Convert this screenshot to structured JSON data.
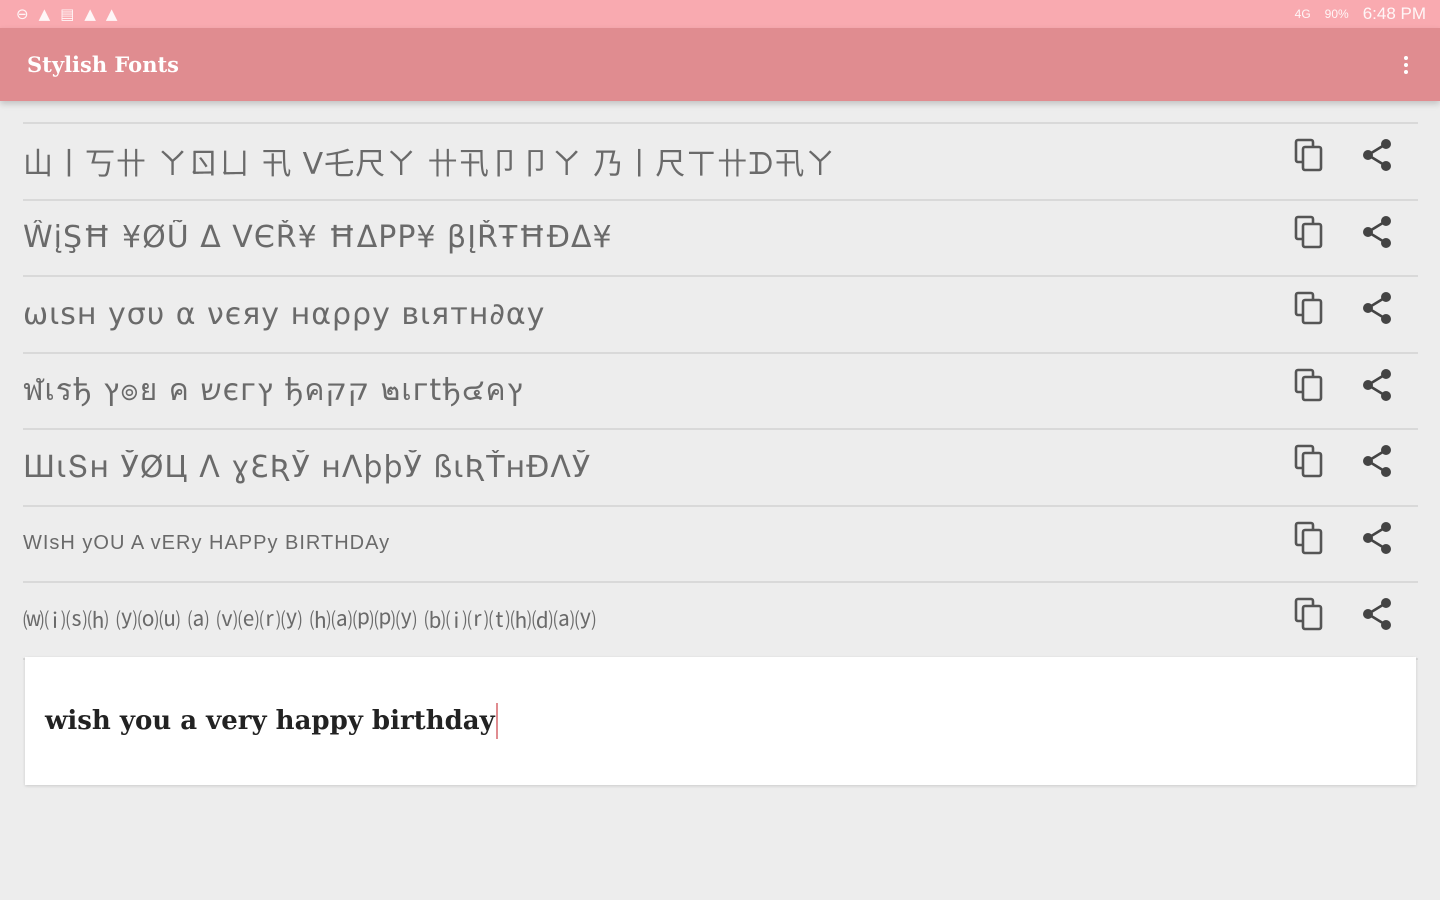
{
  "status_bar": {
    "left_icons": [
      "circle-icon",
      "warning-icon",
      "image-icon",
      "warning-icon",
      "warning-icon"
    ],
    "network": "4G",
    "battery": "90%",
    "time": "6:48 PM"
  },
  "app_bar": {
    "title": "Stylish Fonts",
    "menu_icon": "overflow-menu-icon"
  },
  "fonts": [
    {
      "text": "山丨丂卄 ㄚㄖㄩ 卂 ᐯ乇尺ㄚ 卄卂卩卩ㄚ 乃丨尺ㄒ卄ᗪ卂ㄚ",
      "style": "large"
    },
    {
      "text": "ŴįŞĦ ¥ØŨ Δ VЄŘ¥ ĦΔPP¥ βĮŘŦĦĐΔ¥",
      "style": "large"
    },
    {
      "text": "ωιѕн уσυ α νєяу нαρρу вιятн∂αу",
      "style": "large"
    },
    {
      "text": "ฬเรђ ץ๏ย ค שєгץ ђคקק ๒เгtђ๔คץ",
      "style": "large"
    },
    {
      "text": "ШιՏн ЎØЦ Λ ɣƐƦЎ нΛþþЎ ßιƦŤнÐΛЎ",
      "style": "large"
    },
    {
      "text": "WIsH yOU A vERy HAPPy BIRTHDAy",
      "style": "small"
    },
    {
      "text": "⒲⒤⒮⒣ ⒴⒪⒰ ⒜ ⒱⒠⒭⒴ ⒣⒜⒫⒫⒴ ⒝⒤⒭⒯⒣⒟⒜⒴",
      "style": "tiny"
    }
  ],
  "actions": {
    "copy_icon": "copy-icon",
    "share_icon": "share-icon"
  },
  "input": {
    "value": "wish you a very happy birthday"
  },
  "colors": {
    "status_bar": "#f9aab0",
    "app_bar": "#e08c90",
    "background": "#ededed"
  }
}
